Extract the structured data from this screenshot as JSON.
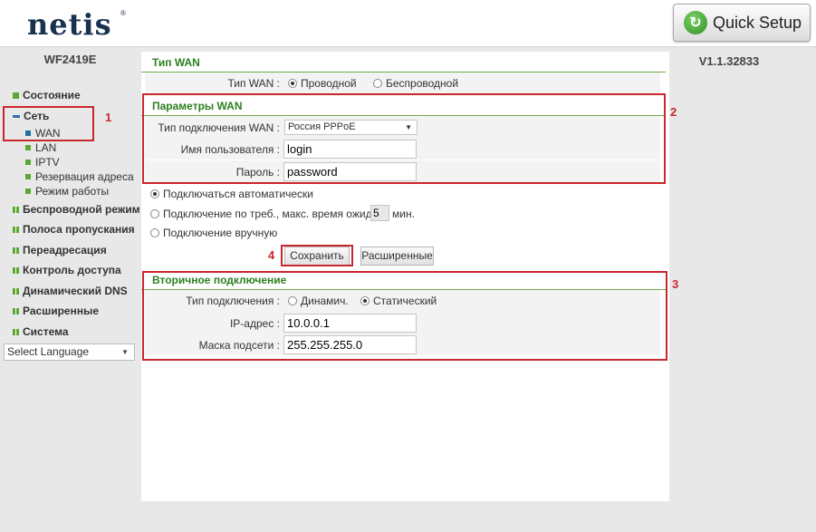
{
  "header": {
    "logo": "netis",
    "logo_mark": "®",
    "quick_setup_label": "Quick Setup",
    "quick_setup_icon": "refresh-arrow-icon"
  },
  "sidebar": {
    "model": "WF2419E",
    "items": [
      {
        "label": "Состояние"
      },
      {
        "label": "Сеть"
      },
      {
        "label": "Беспроводной режим"
      },
      {
        "label": "Полоса пропускания"
      },
      {
        "label": "Переадресация"
      },
      {
        "label": "Контроль доступа"
      },
      {
        "label": "Динамический DNS"
      },
      {
        "label": "Расширенные"
      },
      {
        "label": "Система"
      }
    ],
    "subitems": [
      {
        "label": "WAN"
      },
      {
        "label": "LAN"
      },
      {
        "label": "IPTV"
      },
      {
        "label": "Резервация адреса"
      },
      {
        "label": "Режим работы"
      }
    ],
    "language_select": "Select Language"
  },
  "version": "V1.1.32833",
  "wan_type": {
    "title": "Тип WAN",
    "label": "Тип WAN :",
    "options": [
      "Проводной",
      "Беспроводной"
    ],
    "selected": "Проводной"
  },
  "wan_params": {
    "title": "Параметры WAN",
    "connection_type_label": "Тип подключения WAN :",
    "connection_type_value": "Россия PPPoE",
    "username_label": "Имя пользователя :",
    "username_value": "login",
    "password_label": "Пароль :",
    "password_value": "password"
  },
  "connect_options": {
    "auto": "Подключаться автоматически",
    "on_demand": "Подключение по треб., макс. время ожид.",
    "on_demand_minutes": "5",
    "minutes_unit": "мин.",
    "manual": "Подключение вручную",
    "selected": "auto"
  },
  "buttons": {
    "save": "Сохранить",
    "advanced": "Расширенные"
  },
  "secondary": {
    "title": "Вторичное подключение",
    "type_label": "Тип подключения :",
    "type_options": [
      "Динамич.",
      "Статический"
    ],
    "type_selected": "Статический",
    "ip_label": "IP-адрес :",
    "ip_value": "10.0.0.1",
    "mask_label": "Маска подсети :",
    "mask_value": "255.255.255.0"
  },
  "annotations": {
    "n1": "1",
    "n2": "2",
    "n3": "3",
    "n4": "4",
    "color": "#c8272e"
  },
  "colors": {
    "accent_green": "#5aa832",
    "section_green": "#2d7f1f",
    "brand_navy": "#18324f"
  }
}
